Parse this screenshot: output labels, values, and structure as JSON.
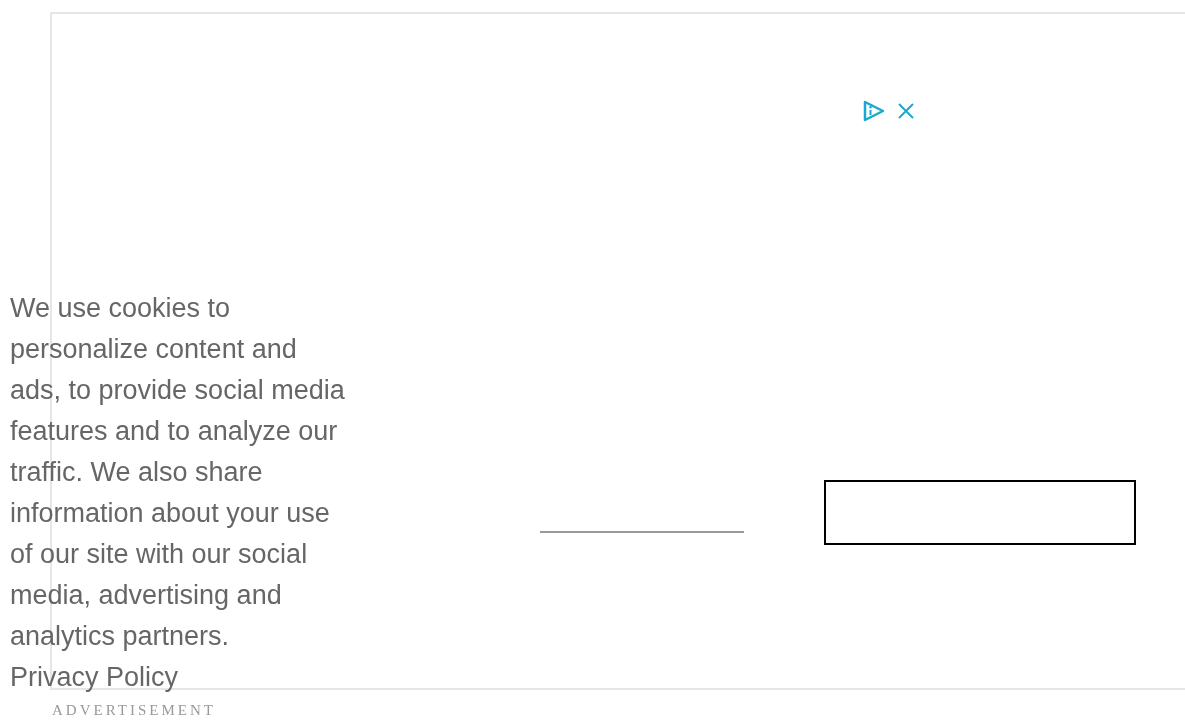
{
  "ad": {
    "label": "ADVERTISEMENT"
  },
  "cookie_notice": {
    "text": "We use cookies to personalize content and ads, to provide social media features and to analyze our traffic. We also share information about your use of our site with our social media, advertising and analytics partners.",
    "link": "Privacy Policy"
  }
}
